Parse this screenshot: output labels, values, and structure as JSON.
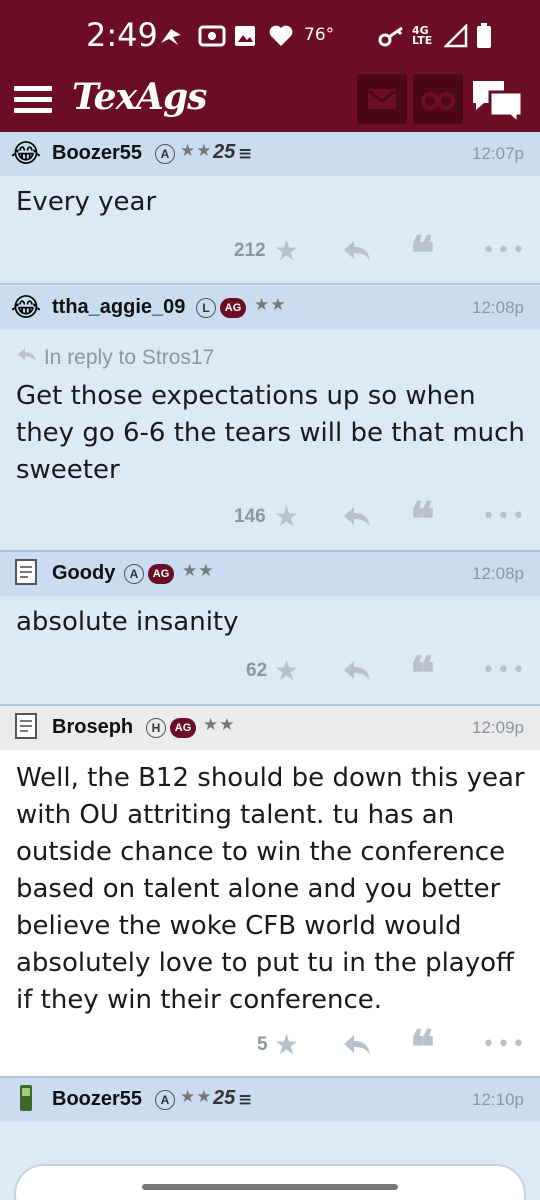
{
  "status_bar": {
    "time": "2:49",
    "temperature": "76°",
    "network": "4G LTE"
  },
  "header": {
    "logo": "TexAgs",
    "icons": [
      "menu-icon",
      "mail-icon",
      "binoculars-icon",
      "chat-icon"
    ]
  },
  "posts": [
    {
      "username": "Boozer55",
      "badges": [
        "A"
      ],
      "stars": "★★",
      "number": "25",
      "time": "12:07p",
      "body": "Every year",
      "likes": "212"
    },
    {
      "username": "ttha_aggie_09",
      "badges": [
        "L",
        "AG"
      ],
      "stars": "★★",
      "time": "12:08p",
      "reply_to": "In reply to Stros17",
      "body": "Get those expectations up so when they go 6-6 the tears will be that much sweeter",
      "likes": "146"
    },
    {
      "username": "Goody",
      "badges": [
        "A",
        "AG"
      ],
      "stars": "★★",
      "time": "12:08p",
      "body": "absolute insanity",
      "likes": "62"
    },
    {
      "username": "Broseph",
      "badges": [
        "H",
        "AG"
      ],
      "stars": "★★",
      "time": "12:09p",
      "body": "Well, the B12 should be down this year with OU attriting talent. tu has an outside chance to win the conference based on talent alone and you better believe the woke CFB world would absolutely love to put tu in the playoff if they win their conference.",
      "likes": "5"
    },
    {
      "username": "Boozer55",
      "badges": [
        "A"
      ],
      "stars": "★★",
      "number": "25",
      "time": "12:10p"
    }
  ],
  "colors": {
    "maroon": "#6b0d24",
    "post_bg": "#dce9f7",
    "header_bg": "#c9dcf1"
  }
}
